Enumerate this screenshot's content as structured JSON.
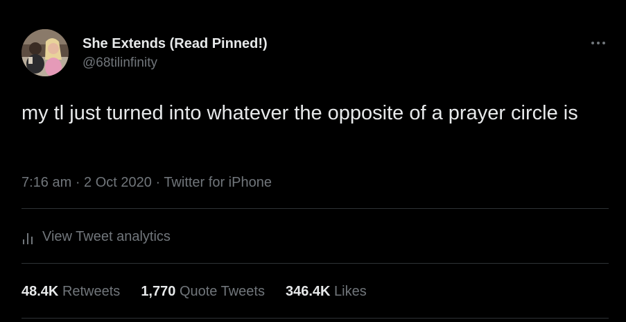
{
  "author": {
    "display_name": "She Extends (Read Pinned!)",
    "handle": "@68tilinfinity",
    "avatar_icon": "profile-photo"
  },
  "more_icon": "ellipsis-icon",
  "tweet": {
    "text": "my tl just turned into whatever the opposite of a prayer circle is",
    "time": "7:16 am",
    "date": "2 Oct 2020",
    "source": "Twitter for iPhone",
    "separator": " · "
  },
  "analytics": {
    "icon": "bar-chart-icon",
    "label": "View Tweet analytics"
  },
  "stats": [
    {
      "value": "48.4K",
      "label": "Retweets"
    },
    {
      "value": "1,770",
      "label": "Quote Tweets"
    },
    {
      "value": "346.4K",
      "label": "Likes"
    }
  ],
  "colors": {
    "background": "#000000",
    "primary_text": "#e7e9ea",
    "secondary_text": "#71767b",
    "divider": "#2f3336"
  }
}
